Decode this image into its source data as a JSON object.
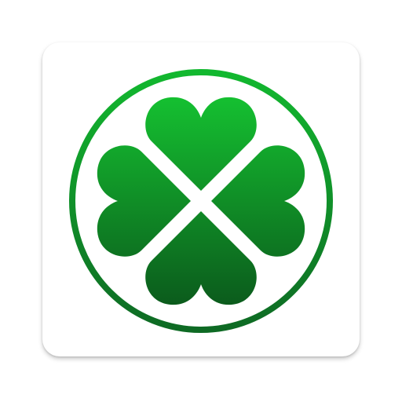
{
  "icon": {
    "name": "four-leaf-clover-icon",
    "background_color": "#ffffff",
    "ring_color_top": "#12b82f",
    "ring_color_bottom": "#0e6a24",
    "leaf_color_top": "#15c231",
    "leaf_color_bottom": "#0b5a1c",
    "divider_color": "#ffffff"
  }
}
